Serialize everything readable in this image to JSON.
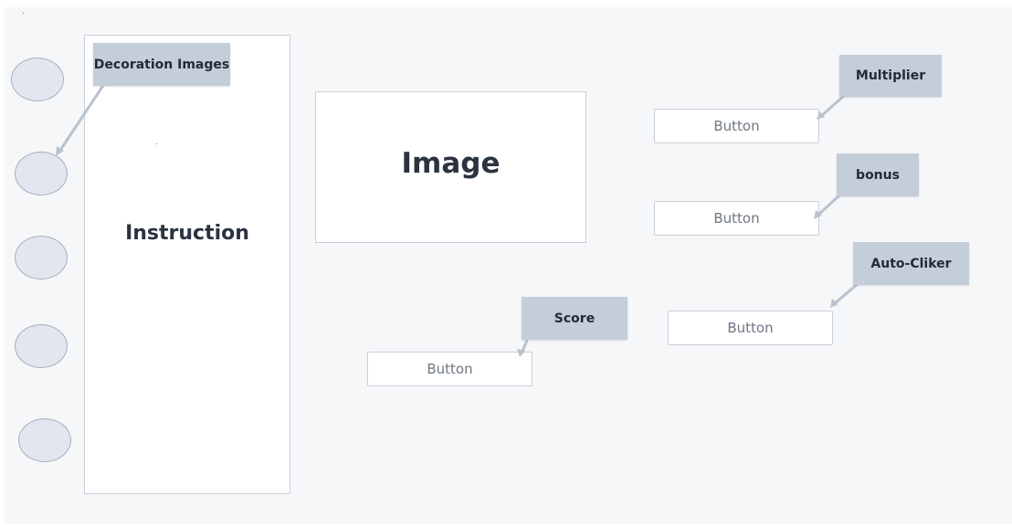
{
  "instruction_panel": {
    "title": "Instruction"
  },
  "image_panel": {
    "title": "Image"
  },
  "buttons": {
    "multiplier": "Button",
    "bonus": "Button",
    "auto_clicker": "Button",
    "score": "Button"
  },
  "notes": {
    "decoration": "Decoration Images",
    "multiplier": "Multiplier",
    "bonus": "bonus",
    "auto_clicker": "Auto-Cliker",
    "score": "Score"
  },
  "decoration_circles": 5,
  "colors": {
    "background": "#f6f7f9",
    "panel_border": "#c9ced7",
    "note_fill": "#c4ced8",
    "circle_fill": "#e2e6ee",
    "circle_stroke": "#a7afbd",
    "arrow": "#b9c3cd"
  }
}
